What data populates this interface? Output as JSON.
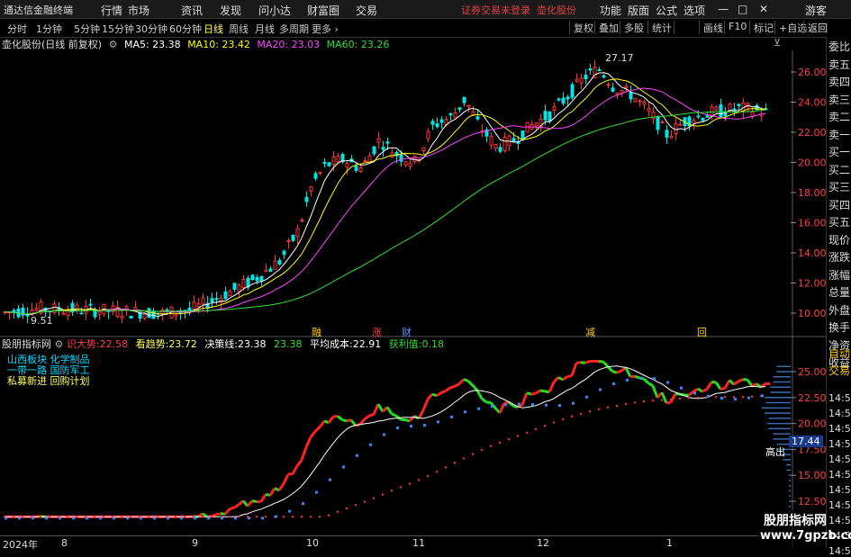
{
  "app": {
    "title": "通达信金融终端"
  },
  "menu": [
    "行情",
    "市场",
    "资讯",
    "发现",
    "问小达",
    "财富圈",
    "交易"
  ],
  "status_text": "证券交易未登录",
  "status_stock": "壶化股份",
  "right_menu": [
    "功能",
    "版面",
    "公式",
    "选项"
  ],
  "window_controls": {
    "min": "—",
    "max": "□",
    "close": "✕"
  },
  "user": "游客",
  "periods": [
    "分时",
    "1分钟",
    "5分钟",
    "15分钟",
    "30分钟",
    "60分钟",
    "日线",
    "周线",
    "月线",
    "多周期",
    "更多"
  ],
  "active_period": "日线",
  "right_tabs": [
    "复权",
    "叠加",
    "多股",
    "统计",
    "画线",
    "F10",
    "标记",
    "+自选",
    "返回"
  ],
  "info": {
    "stock": "壶化股份(日线 前复权)",
    "ma5": "MA5: 23.38",
    "ma10": "MA10: 23.42",
    "ma20": "MA20: 23.03",
    "ma60": "MA60: 23.26",
    "colors": {
      "ma5": "#ffffff",
      "ma10": "#ffff00",
      "ma20": "#ff44ff",
      "ma60": "#33dd33"
    }
  },
  "price_axis": [
    "26.00",
    "24.00",
    "22.00",
    "20.00",
    "18.00",
    "16.00",
    "14.00",
    "12.00",
    "10.00"
  ],
  "high_label": "27.17",
  "low_label": "9.51",
  "event_markers": [
    {
      "text": "融",
      "color": "#ffcc00"
    },
    {
      "text": "涨",
      "color": "#ff4040"
    },
    {
      "text": "财",
      "color": "#5599ff"
    },
    {
      "text": "减",
      "color": "#ffcc00"
    },
    {
      "text": "回",
      "color": "#ffcc00"
    }
  ],
  "indicator": {
    "name": "股朋指标网",
    "items": [
      {
        "label": "识大势:",
        "value": "22.58",
        "color": "#ff4040"
      },
      {
        "label": "看趋势:",
        "value": "23.72",
        "color": "#ffff66"
      },
      {
        "label": "决策线:",
        "value": "23.38",
        "color": "#ffffff"
      },
      {
        "label": "",
        "value": "23.38",
        "color": "#33dd33"
      },
      {
        "label": "平均成本:",
        "value": "22.91",
        "color": "#ffffff"
      },
      {
        "label": "获利值:",
        "value": "0.18",
        "color": "#33dd33"
      }
    ]
  },
  "notes": [
    {
      "text": "山西板块 化学制品",
      "color": "#00ddff"
    },
    {
      "text": "一带一路 国防军工",
      "color": "#00ddff"
    },
    {
      "text": "私募新进 回购计划",
      "color": "#ffff66"
    }
  ],
  "ind_axis": [
    "25.00",
    "22.50",
    "20.00",
    "17.50",
    "15.00",
    "12.50"
  ],
  "ind_tag": "17.44",
  "high_out_label": "高出",
  "date_axis": [
    "2024年",
    "8",
    "9",
    "10",
    "11",
    "12",
    "1"
  ],
  "right_column": [
    "委比",
    "卖五",
    "卖四",
    "卖三",
    "卖二",
    "卖一",
    "买一",
    "买二",
    "买三",
    "买四",
    "买五",
    "现价",
    "涨跌",
    "涨幅",
    "总量",
    "外盘",
    "换手",
    "净资",
    "收益"
  ],
  "right_column2": [
    "自动",
    "交易"
  ],
  "time_rows": [
    "14:55",
    "14:55",
    "14:55",
    "14:55",
    "14:55",
    "14:55",
    "14:55",
    "14:56",
    "14:56",
    "14:56",
    "14:56"
  ],
  "watermark": {
    "line1": "股朋指标网",
    "line2": "www.7gpzb.com"
  }
}
